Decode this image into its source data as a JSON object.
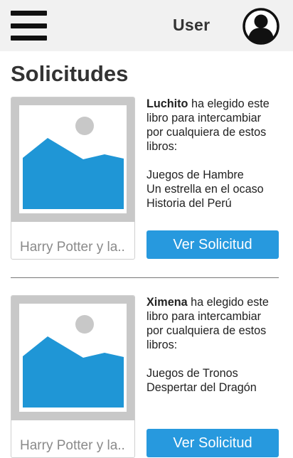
{
  "header": {
    "user_label": "User"
  },
  "page": {
    "title": "Solicitudes"
  },
  "requests": [
    {
      "user": "Luchito",
      "message_line1": " ha elegido este",
      "message_line2": "libro para intercambiar",
      "message_line3": "por cualquiera de estos",
      "message_line4": "libros:",
      "offered_books": [
        "Juegos de Hambre",
        "Un estrella en el ocaso",
        "Historia del Perú"
      ],
      "book_title": "Harry Potter y la..",
      "button_label": "Ver Solicitud"
    },
    {
      "user": "Ximena",
      "message_line1": " ha elegido este",
      "message_line2": "libro para intercambiar",
      "message_line3": "por cualquiera de estos",
      "message_line4": "libros:",
      "offered_books": [
        "Juegos de Tronos",
        "Despertar del Dragón"
      ],
      "book_title": "Harry Potter y la..",
      "button_label": "Ver Solicitud"
    }
  ],
  "colors": {
    "accent": "#2799de",
    "header_bg": "#f1f1f1",
    "image_placeholder": "#c8c8c8",
    "image_mountain": "#1f96d6"
  },
  "icons": {
    "menu": "hamburger-menu-icon",
    "avatar": "user-avatar-icon",
    "book_image": "image-placeholder-icon"
  }
}
